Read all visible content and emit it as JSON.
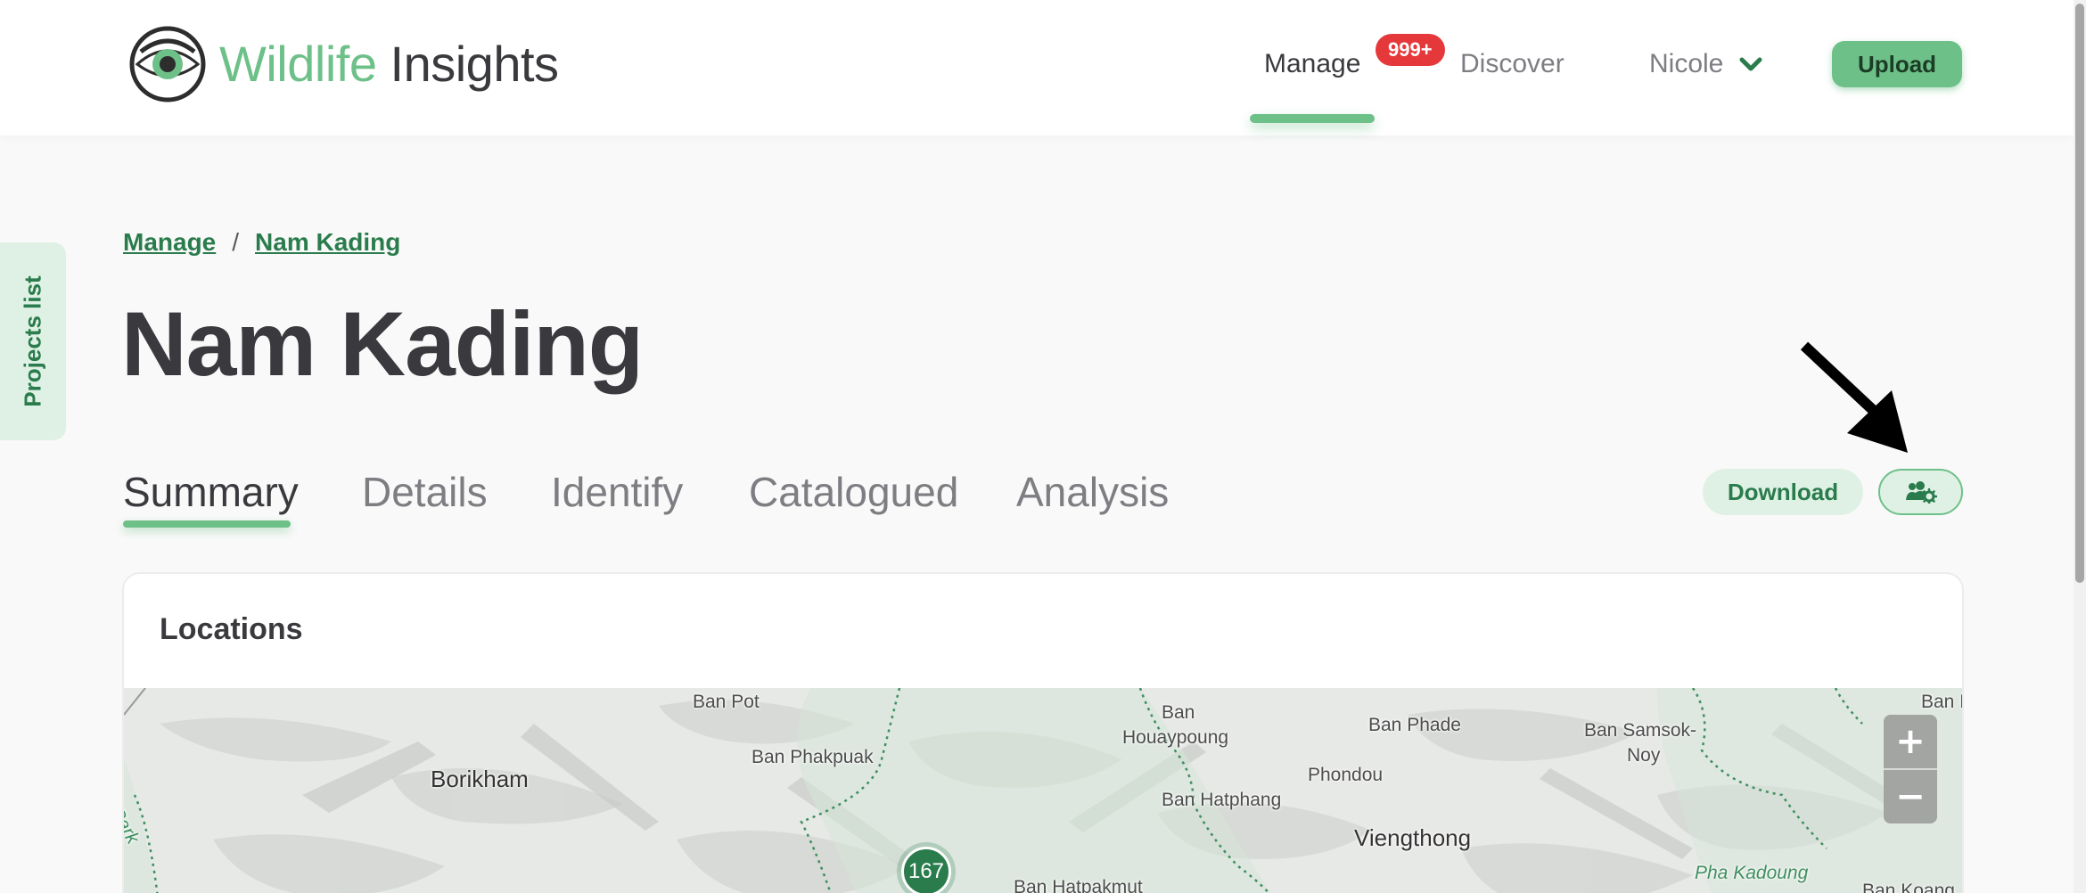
{
  "header": {
    "logo": {
      "word1": "Wildlife",
      "word2": "Insights"
    },
    "nav": {
      "manage": "Manage",
      "badge": "999+",
      "discover": "Discover",
      "user": "Nicole"
    },
    "upload_label": "Upload"
  },
  "sidebar_tab": {
    "label": "Projects list"
  },
  "breadcrumb": {
    "root": "Manage",
    "separator": "/",
    "current": "Nam Kading"
  },
  "page_title": "Nam Kading",
  "tabs": [
    {
      "label": "Summary",
      "active": true
    },
    {
      "label": "Details",
      "active": false
    },
    {
      "label": "Identify",
      "active": false
    },
    {
      "label": "Catalogued",
      "active": false
    },
    {
      "label": "Analysis",
      "active": false
    }
  ],
  "actions": {
    "download_label": "Download",
    "settings_icon": "users-cog-icon"
  },
  "locations": {
    "title": "Locations",
    "cluster_count": "167",
    "zoom_in": "+",
    "zoom_out": "−",
    "map_labels": {
      "ban_pot": "Ban Pot",
      "borikham": "Borikham",
      "ban_phakpuak": "Ban Phakpuak",
      "ban_houaypoung_1": "Ban",
      "ban_houaypoung_2": "Houaypoung",
      "ban_phade": "Ban Phade",
      "phondou": "Phondou",
      "ban_hatphang": "Ban Hatphang",
      "viengthong": "Viengthong",
      "ban_samsok_1": "Ban Samsok-",
      "ban_samsok_2": "Noy",
      "ban_h": "Ban H",
      "pha_kadoung": "Pha Kadoung",
      "ban_hatpakmut": "Ban Hatpakmut",
      "ban_koang": "Ban Koang",
      "park": "Park"
    }
  },
  "colors": {
    "brand_green": "#6ec089",
    "dark_green": "#2a7c4c",
    "light_green": "#dff1e5",
    "badge_red": "#e5383b",
    "text_dark": "#3a3a3e"
  }
}
